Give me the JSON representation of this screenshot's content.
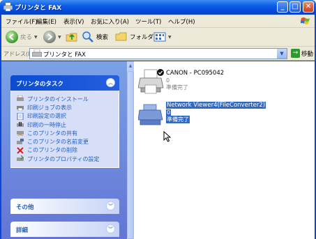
{
  "window": {
    "title": "プリンタと FAX"
  },
  "menu": [
    "ファイル(F)",
    "編集(E)",
    "表示(V)",
    "お気に入り(A)",
    "ツール(T)",
    "ヘルプ(H)"
  ],
  "toolbar": {
    "back_label": "戻る",
    "search_label": "検索",
    "folders_label": "フォルダ"
  },
  "address": {
    "label": "アドレス(D)",
    "value": "プリンタと FAX",
    "go_label": "移動"
  },
  "tasks_panel": {
    "title": "プリンタのタスク",
    "items": [
      "プリンタのインストール",
      "印刷ジョブの表示",
      "印刷設定の選択",
      "印刷の一時停止",
      "このプリンタの共有",
      "このプリンタの名前変更",
      "このプリンタの削除",
      "プリンタのプロパティの設定"
    ]
  },
  "other_panel": {
    "title": "その他"
  },
  "details_panel": {
    "title": "詳細"
  },
  "printers": [
    {
      "name": "CANON - PC095042",
      "count": "0",
      "status": "準備完了",
      "default": true
    },
    {
      "name": "Network Viewer4(FileConverter2)",
      "count": "0",
      "status": "準備完了",
      "selected": true
    }
  ],
  "colors": {
    "title_bar": "#0a46d8",
    "task_pane": "#6f8ee0",
    "selection": "#316ac5",
    "link": "#215dc6"
  }
}
